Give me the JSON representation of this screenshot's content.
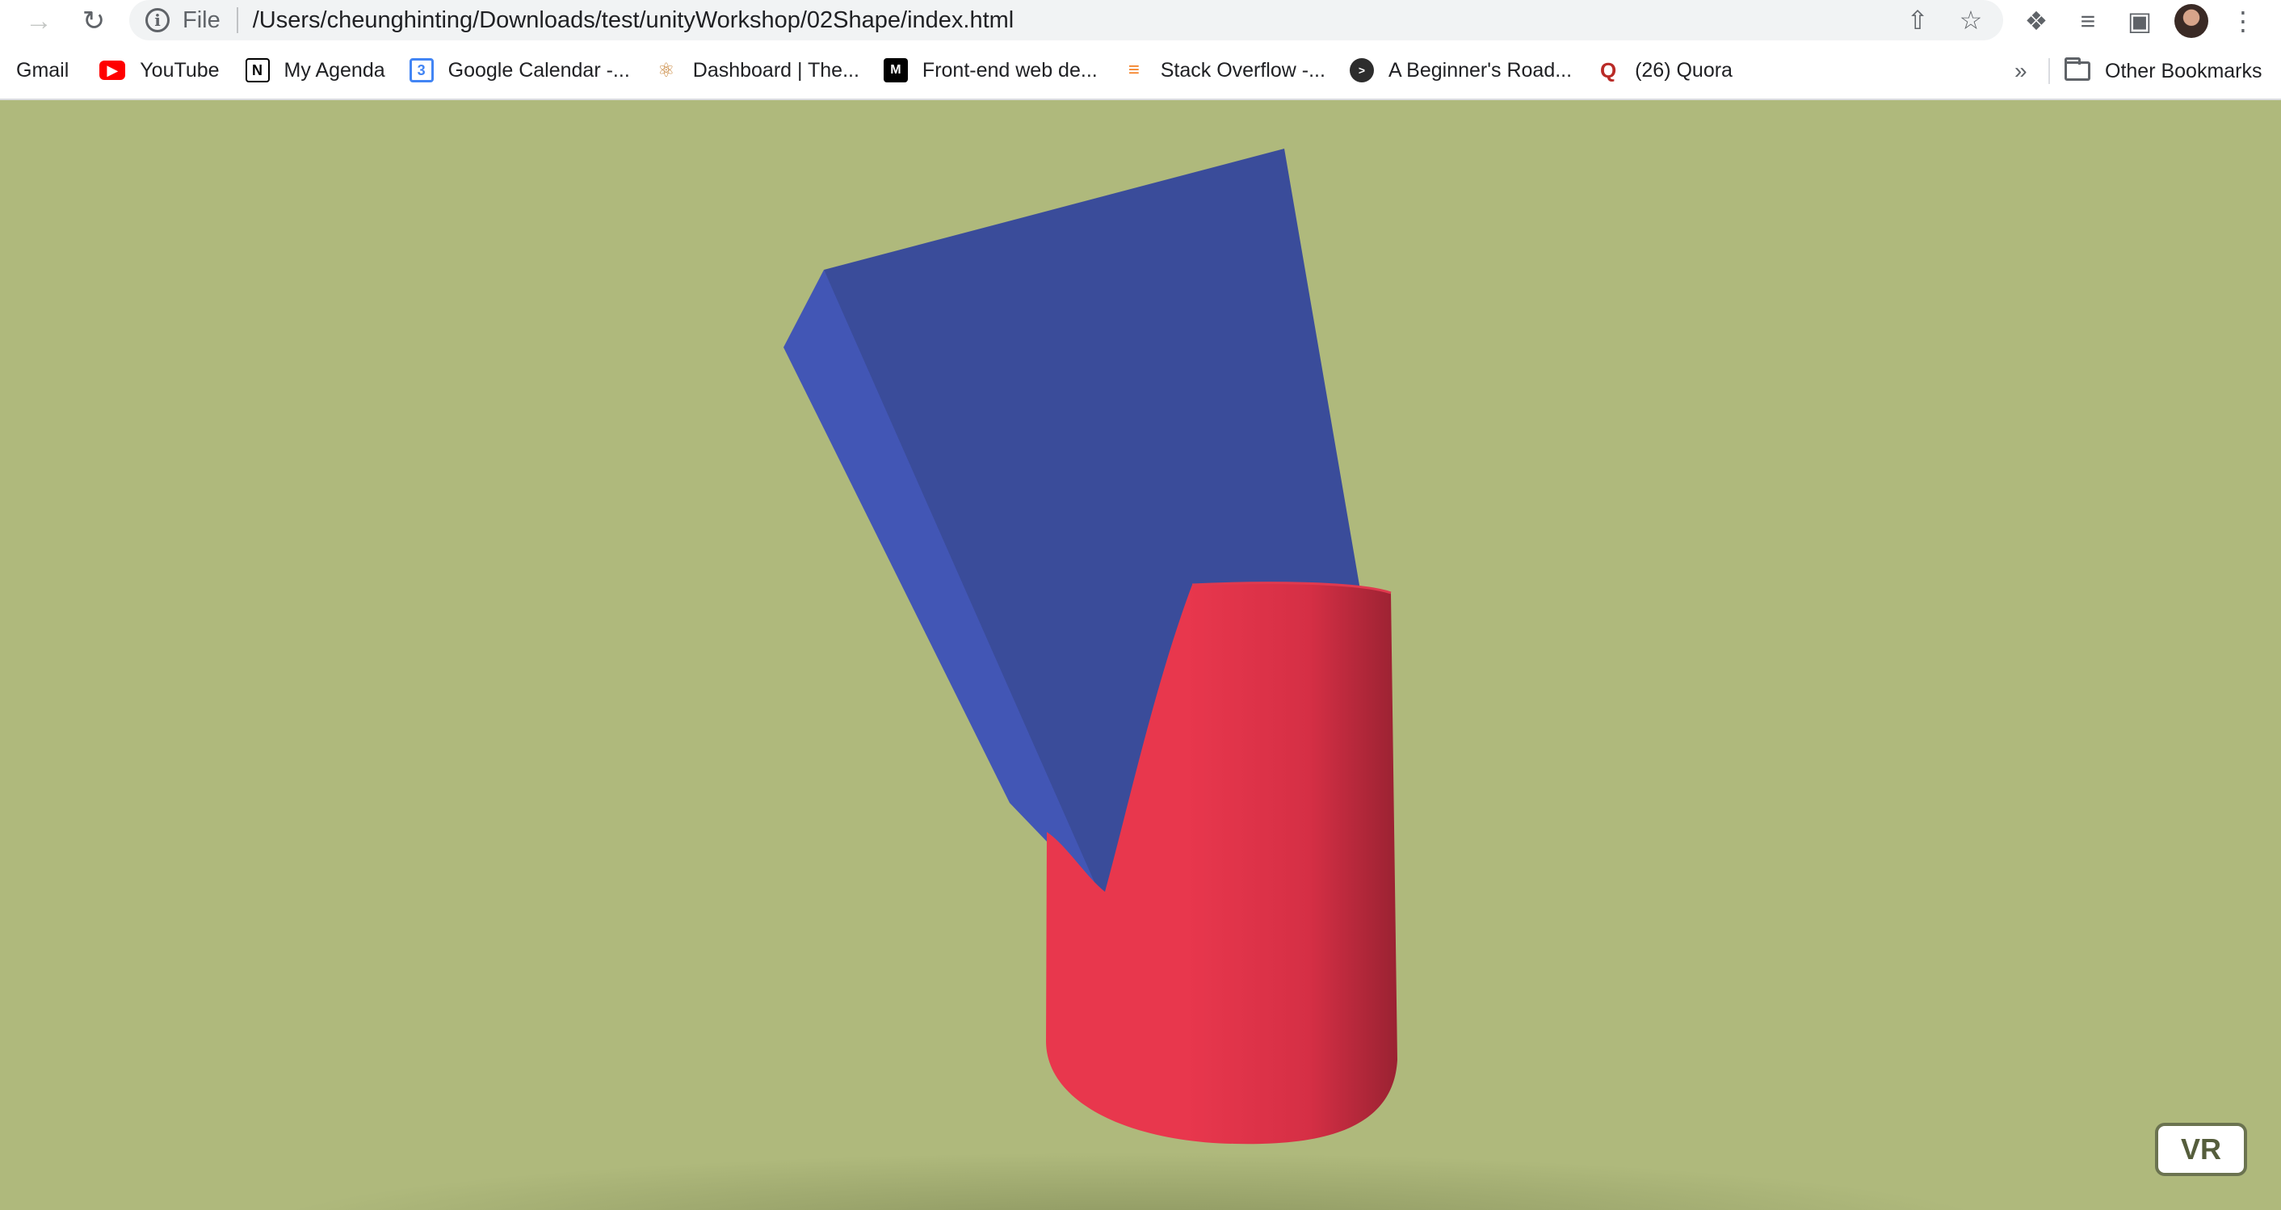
{
  "browser": {
    "scheme_label": "File",
    "url": "/Users/cheunghinting/Downloads/test/unityWorkshop/02Shape/index.html"
  },
  "bookmarks": [
    {
      "label": "Gmail",
      "icon": "gmail-icon"
    },
    {
      "label": "YouTube",
      "icon": "youtube-icon"
    },
    {
      "label": "My Agenda",
      "icon": "notion-icon"
    },
    {
      "label": "Google Calendar -...",
      "icon": "google-calendar-icon"
    },
    {
      "label": "Dashboard | The...",
      "icon": "dashboard-icon"
    },
    {
      "label": "Front-end web de...",
      "icon": "mdn-icon"
    },
    {
      "label": "Stack Overflow -...",
      "icon": "stack-overflow-icon"
    },
    {
      "label": "A Beginner's Road...",
      "icon": "terminal-icon"
    },
    {
      "label": "(26) Quora",
      "icon": "quora-icon"
    }
  ],
  "bookmarks_overflow": "»",
  "other_bookmarks": "Other Bookmarks",
  "scene": {
    "background_color": "#afb97c",
    "box_color": "#3a4c9a",
    "cylinder_color": "#e8374d"
  },
  "vr_button": "VR"
}
